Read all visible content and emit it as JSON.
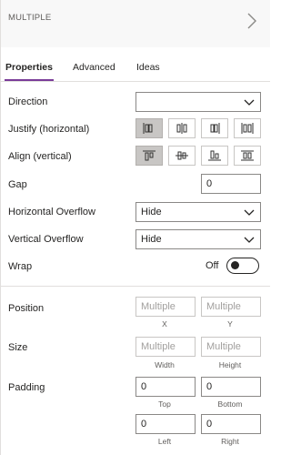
{
  "header": {
    "title": "MULTIPLE",
    "chevron_icon": "chevron-right-icon"
  },
  "tabs": [
    {
      "label": "Properties",
      "active": true
    },
    {
      "label": "Advanced",
      "active": false
    },
    {
      "label": "Ideas",
      "active": false
    }
  ],
  "properties": {
    "direction": {
      "label": "Direction",
      "value": ""
    },
    "justify": {
      "label": "Justify (horizontal)",
      "options": [
        {
          "icon": "justify-start-icon",
          "selected": true
        },
        {
          "icon": "justify-center-icon",
          "selected": false
        },
        {
          "icon": "justify-end-icon",
          "selected": false
        },
        {
          "icon": "justify-space-between-icon",
          "selected": false
        }
      ]
    },
    "align": {
      "label": "Align (vertical)",
      "options": [
        {
          "icon": "align-top-icon",
          "selected": true
        },
        {
          "icon": "align-middle-icon",
          "selected": false
        },
        {
          "icon": "align-bottom-icon",
          "selected": false
        },
        {
          "icon": "align-stretch-icon",
          "selected": false
        }
      ]
    },
    "gap": {
      "label": "Gap",
      "value": "0"
    },
    "horizontal_overflow": {
      "label": "Horizontal Overflow",
      "value": "Hide"
    },
    "vertical_overflow": {
      "label": "Vertical Overflow",
      "value": "Hide"
    },
    "wrap": {
      "label": "Wrap",
      "state_text": "Off",
      "on": false
    },
    "position": {
      "label": "Position",
      "x": {
        "placeholder": "Multiple",
        "caption": "X"
      },
      "y": {
        "placeholder": "Multiple",
        "caption": "Y"
      }
    },
    "size": {
      "label": "Size",
      "width": {
        "placeholder": "Multiple",
        "caption": "Width"
      },
      "height": {
        "placeholder": "Multiple",
        "caption": "Height"
      }
    },
    "padding": {
      "label": "Padding",
      "top": {
        "value": "0",
        "caption": "Top"
      },
      "bottom": {
        "value": "0",
        "caption": "Bottom"
      },
      "left": {
        "value": "0",
        "caption": "Left"
      },
      "right": {
        "value": "0",
        "caption": "Right"
      }
    }
  },
  "colors": {
    "accent": "#7a3b98",
    "selected_segment": "#c8c6c4",
    "border": "#8a8886"
  }
}
